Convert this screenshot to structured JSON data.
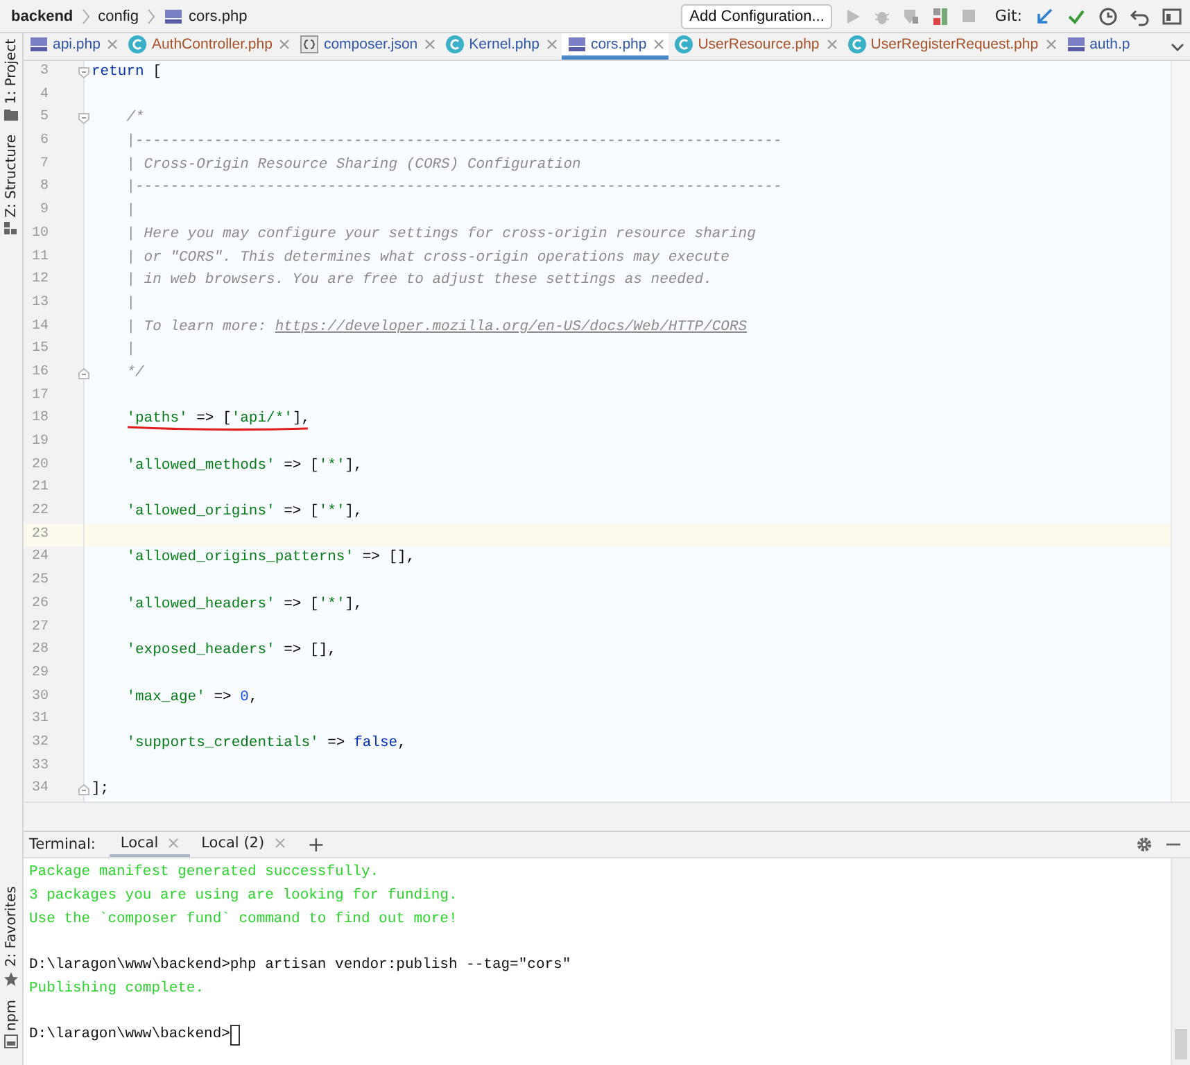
{
  "breadcrumb": [
    {
      "label": "backend",
      "kind": "project"
    },
    {
      "label": "config",
      "kind": "folder"
    },
    {
      "label": "cors.php",
      "kind": "php"
    }
  ],
  "toolbar": {
    "run_config": "Add Configuration...",
    "git_label": "Git:"
  },
  "side_tools_top": [
    "1: Project",
    "Z: Structure"
  ],
  "side_tools_bottom": [
    "2: Favorites",
    "npm"
  ],
  "tabs": [
    {
      "label": "api.php",
      "kind": "php",
      "color": "#2f56a8",
      "selected": false,
      "closable": true
    },
    {
      "label": "AuthController.php",
      "kind": "class",
      "color": "#a8522a",
      "selected": false,
      "closable": true
    },
    {
      "label": "composer.json",
      "kind": "json",
      "color": "#2f56a8",
      "selected": false,
      "closable": true
    },
    {
      "label": "Kernel.php",
      "kind": "class",
      "color": "#2f56a8",
      "selected": false,
      "closable": true
    },
    {
      "label": "cors.php",
      "kind": "php",
      "color": "#2f56a8",
      "selected": true,
      "closable": true
    },
    {
      "label": "UserResource.php",
      "kind": "class",
      "color": "#a8522a",
      "selected": false,
      "closable": true
    },
    {
      "label": "UserRegisterRequest.php",
      "kind": "class",
      "color": "#a8522a",
      "selected": false,
      "closable": true
    },
    {
      "label": "auth.p",
      "kind": "php",
      "color": "#2f56a8",
      "selected": false,
      "closable": false
    }
  ],
  "editor": {
    "lines": [
      {
        "number": "3",
        "fold_start": true,
        "tokens": [
          {
            "kind": "keyword",
            "text": "return"
          },
          {
            "kind": "plain",
            "text": " ["
          }
        ]
      },
      {
        "number": "4"
      },
      {
        "number": "5",
        "fold_start": true,
        "tokens": [
          {
            "kind": "comment",
            "text": "    /*"
          }
        ]
      },
      {
        "number": "6",
        "tokens": [
          {
            "kind": "comment",
            "text": "    |--------------------------------------------------------------------------"
          }
        ]
      },
      {
        "number": "7",
        "tokens": [
          {
            "kind": "comment",
            "text": "    | Cross-Origin Resource Sharing (CORS) Configuration"
          }
        ]
      },
      {
        "number": "8",
        "tokens": [
          {
            "kind": "comment",
            "text": "    |--------------------------------------------------------------------------"
          }
        ]
      },
      {
        "number": "9",
        "tokens": [
          {
            "kind": "comment",
            "text": "    |"
          }
        ]
      },
      {
        "number": "10",
        "tokens": [
          {
            "kind": "comment",
            "text": "    | Here you may configure your settings for cross-origin resource sharing"
          }
        ]
      },
      {
        "number": "11",
        "tokens": [
          {
            "kind": "comment",
            "text": "    | or \"CORS\". This determines what cross-origin operations may execute"
          }
        ]
      },
      {
        "number": "12",
        "tokens": [
          {
            "kind": "comment",
            "text": "    | in web browsers. You are free to adjust these settings as needed."
          }
        ]
      },
      {
        "number": "13",
        "tokens": [
          {
            "kind": "comment",
            "text": "    |"
          }
        ]
      },
      {
        "number": "14",
        "tokens": [
          {
            "kind": "comment",
            "text": "    | To learn more: "
          },
          {
            "kind": "link",
            "text": "https://developer.mozilla.org/en-US/docs/Web/HTTP/CORS"
          }
        ]
      },
      {
        "number": "15",
        "tokens": [
          {
            "kind": "comment",
            "text": "    |"
          }
        ]
      },
      {
        "number": "16",
        "fold_end": true,
        "tokens": [
          {
            "kind": "comment",
            "text": "    */"
          }
        ]
      },
      {
        "number": "17"
      },
      {
        "number": "18",
        "underlined": true,
        "tokens": [
          {
            "kind": "string",
            "text": "    'paths'"
          },
          {
            "kind": "plain",
            "text": " => ["
          },
          {
            "kind": "string",
            "text": "'api/*'"
          },
          {
            "kind": "plain",
            "text": "],"
          }
        ]
      },
      {
        "number": "19"
      },
      {
        "number": "20",
        "tokens": [
          {
            "kind": "string",
            "text": "    'allowed_methods'"
          },
          {
            "kind": "plain",
            "text": " => ["
          },
          {
            "kind": "string",
            "text": "'*'"
          },
          {
            "kind": "plain",
            "text": "],"
          }
        ]
      },
      {
        "number": "21"
      },
      {
        "number": "22",
        "tokens": [
          {
            "kind": "string",
            "text": "    'allowed_origins'"
          },
          {
            "kind": "plain",
            "text": " => ["
          },
          {
            "kind": "string",
            "text": "'*'"
          },
          {
            "kind": "plain",
            "text": "],"
          }
        ]
      },
      {
        "number": "23",
        "current": true
      },
      {
        "number": "24",
        "tokens": [
          {
            "kind": "string",
            "text": "    'allowed_origins_patterns'"
          },
          {
            "kind": "plain",
            "text": " => [],"
          }
        ]
      },
      {
        "number": "25"
      },
      {
        "number": "26",
        "tokens": [
          {
            "kind": "string",
            "text": "    'allowed_headers'"
          },
          {
            "kind": "plain",
            "text": " => ["
          },
          {
            "kind": "string",
            "text": "'*'"
          },
          {
            "kind": "plain",
            "text": "],"
          }
        ]
      },
      {
        "number": "27"
      },
      {
        "number": "28",
        "tokens": [
          {
            "kind": "string",
            "text": "    'exposed_headers'"
          },
          {
            "kind": "plain",
            "text": " => [],"
          }
        ]
      },
      {
        "number": "29"
      },
      {
        "number": "30",
        "tokens": [
          {
            "kind": "string",
            "text": "    'max_age'"
          },
          {
            "kind": "plain",
            "text": " => "
          },
          {
            "kind": "number",
            "text": "0"
          },
          {
            "kind": "plain",
            "text": ","
          }
        ]
      },
      {
        "number": "31"
      },
      {
        "number": "32",
        "tokens": [
          {
            "kind": "string",
            "text": "    'supports_credentials'"
          },
          {
            "kind": "plain",
            "text": " => "
          },
          {
            "kind": "keyword",
            "text": "false"
          },
          {
            "kind": "plain",
            "text": ","
          }
        ]
      },
      {
        "number": "33"
      },
      {
        "number": "34",
        "fold_end": true,
        "tokens": [
          {
            "kind": "plain",
            "text": "];"
          }
        ]
      }
    ]
  },
  "terminal": {
    "label": "Terminal:",
    "tabs": [
      {
        "label": "Local",
        "selected": true
      },
      {
        "label": "Local (2)",
        "selected": false
      }
    ],
    "add": "+",
    "lines": [
      {
        "kind": "output",
        "text": "Package manifest generated successfully."
      },
      {
        "kind": "output",
        "text": "3 packages you are using are looking for funding."
      },
      {
        "kind": "output",
        "text": "Use the `composer fund` command to find out more!"
      },
      {
        "kind": "blank"
      },
      {
        "kind": "prompt",
        "text": "D:\\laragon\\www\\backend>php artisan vendor:publish --tag=\"cors\""
      },
      {
        "kind": "output",
        "text": "Publishing complete."
      },
      {
        "kind": "blank"
      },
      {
        "kind": "prompt",
        "text": "D:\\laragon\\www\\backend>",
        "cursor": true
      }
    ]
  }
}
